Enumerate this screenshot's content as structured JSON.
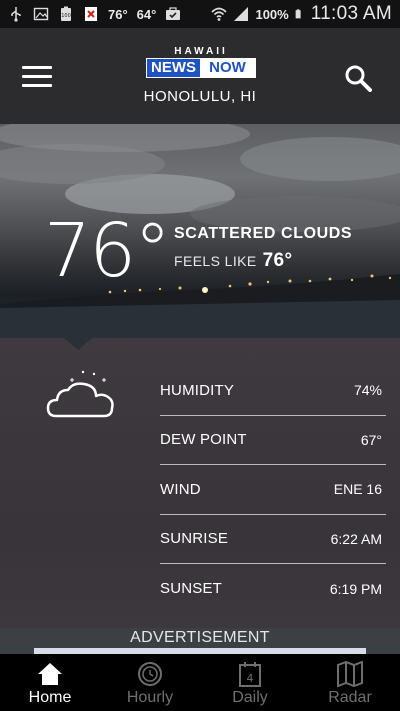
{
  "status_bar": {
    "temp_1": "76°",
    "temp_2": "64°",
    "battery": "100%",
    "time": "11:03 AM",
    "small_badge": "100"
  },
  "header": {
    "logo_top": "HAWAII",
    "logo_news": "NEWS",
    "logo_now": "NOW",
    "location": "HONOLULU, HI",
    "brand_color": "#1d53c4"
  },
  "current": {
    "temperature": "76°",
    "condition": "SCATTERED CLOUDS",
    "feels_like_label": "FEELS LIKE",
    "feels_like_value": "76°",
    "icon": "partly-cloudy-night-icon"
  },
  "details": [
    {
      "label": "HUMIDITY",
      "value": "74%"
    },
    {
      "label": "DEW POINT",
      "value": "67°"
    },
    {
      "label": "WIND",
      "value": "ENE 16"
    },
    {
      "label": "SUNRISE",
      "value": "6:22 AM"
    },
    {
      "label": "SUNSET",
      "value": "6:19 PM"
    }
  ],
  "ad": {
    "label": "ADVERTISEMENT"
  },
  "nav": [
    {
      "label": "Home",
      "icon": "home-icon",
      "active": true
    },
    {
      "label": "Hourly",
      "icon": "clock-icon",
      "active": false
    },
    {
      "label": "Daily",
      "icon": "calendar-icon",
      "active": false,
      "badge": "4"
    },
    {
      "label": "Radar",
      "icon": "map-icon",
      "active": false
    }
  ]
}
